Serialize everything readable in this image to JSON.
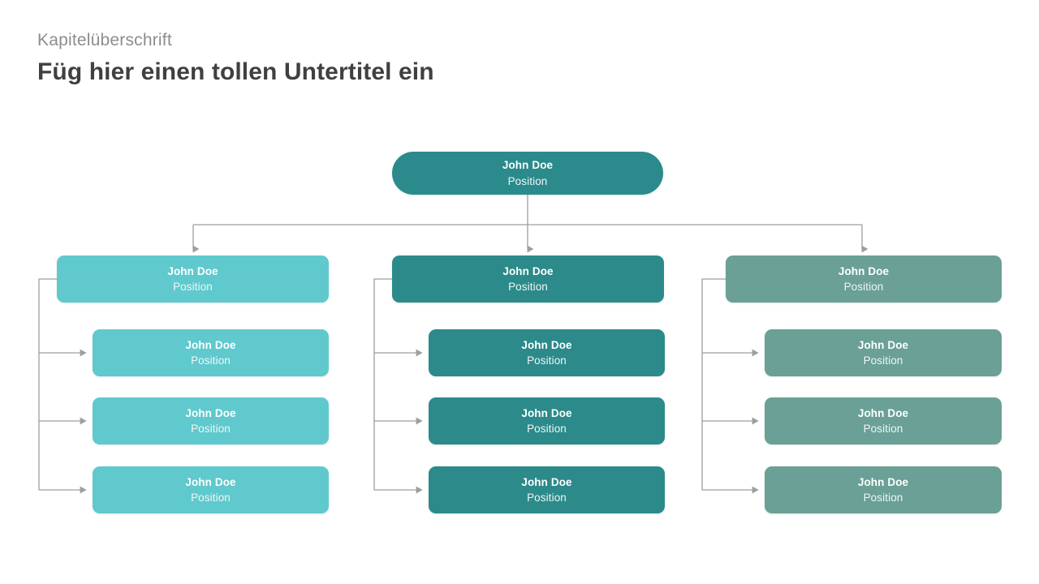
{
  "header": {
    "kicker": "Kapitelüberschrift",
    "title": "Füg hier einen tollen Untertitel ein"
  },
  "colors": {
    "background": "#ffffff",
    "kicker_text": "#8d8d8d",
    "title_text": "#404040",
    "connector": "#9e9e9e",
    "node_text": "#ffffff",
    "root": "#2b8a8c",
    "branch_light": "#5fc9cd",
    "branch_dark": "#2c8a8a",
    "branch_sage": "#6aa095"
  },
  "chart_data": {
    "type": "diagram",
    "diagram_kind": "organizational-chart",
    "levels": 3,
    "root": {
      "name": "John Doe",
      "position": "Position",
      "color": "#2b8a8c",
      "shape": "pill"
    },
    "branches": [
      {
        "id": "branch-1",
        "color": "#5fc9cd",
        "lead": {
          "name": "John Doe",
          "position": "Position"
        },
        "children": [
          {
            "name": "John Doe",
            "position": "Position"
          },
          {
            "name": "John Doe",
            "position": "Position"
          },
          {
            "name": "John Doe",
            "position": "Position"
          }
        ]
      },
      {
        "id": "branch-2",
        "color": "#2c8a8a",
        "lead": {
          "name": "John Doe",
          "position": "Position"
        },
        "children": [
          {
            "name": "John Doe",
            "position": "Position"
          },
          {
            "name": "John Doe",
            "position": "Position"
          },
          {
            "name": "John Doe",
            "position": "Position"
          }
        ]
      },
      {
        "id": "branch-3",
        "color": "#6aa095",
        "lead": {
          "name": "John Doe",
          "position": "Position"
        },
        "children": [
          {
            "name": "John Doe",
            "position": "Position"
          },
          {
            "name": "John Doe",
            "position": "Position"
          },
          {
            "name": "John Doe",
            "position": "Position"
          }
        ]
      }
    ]
  }
}
